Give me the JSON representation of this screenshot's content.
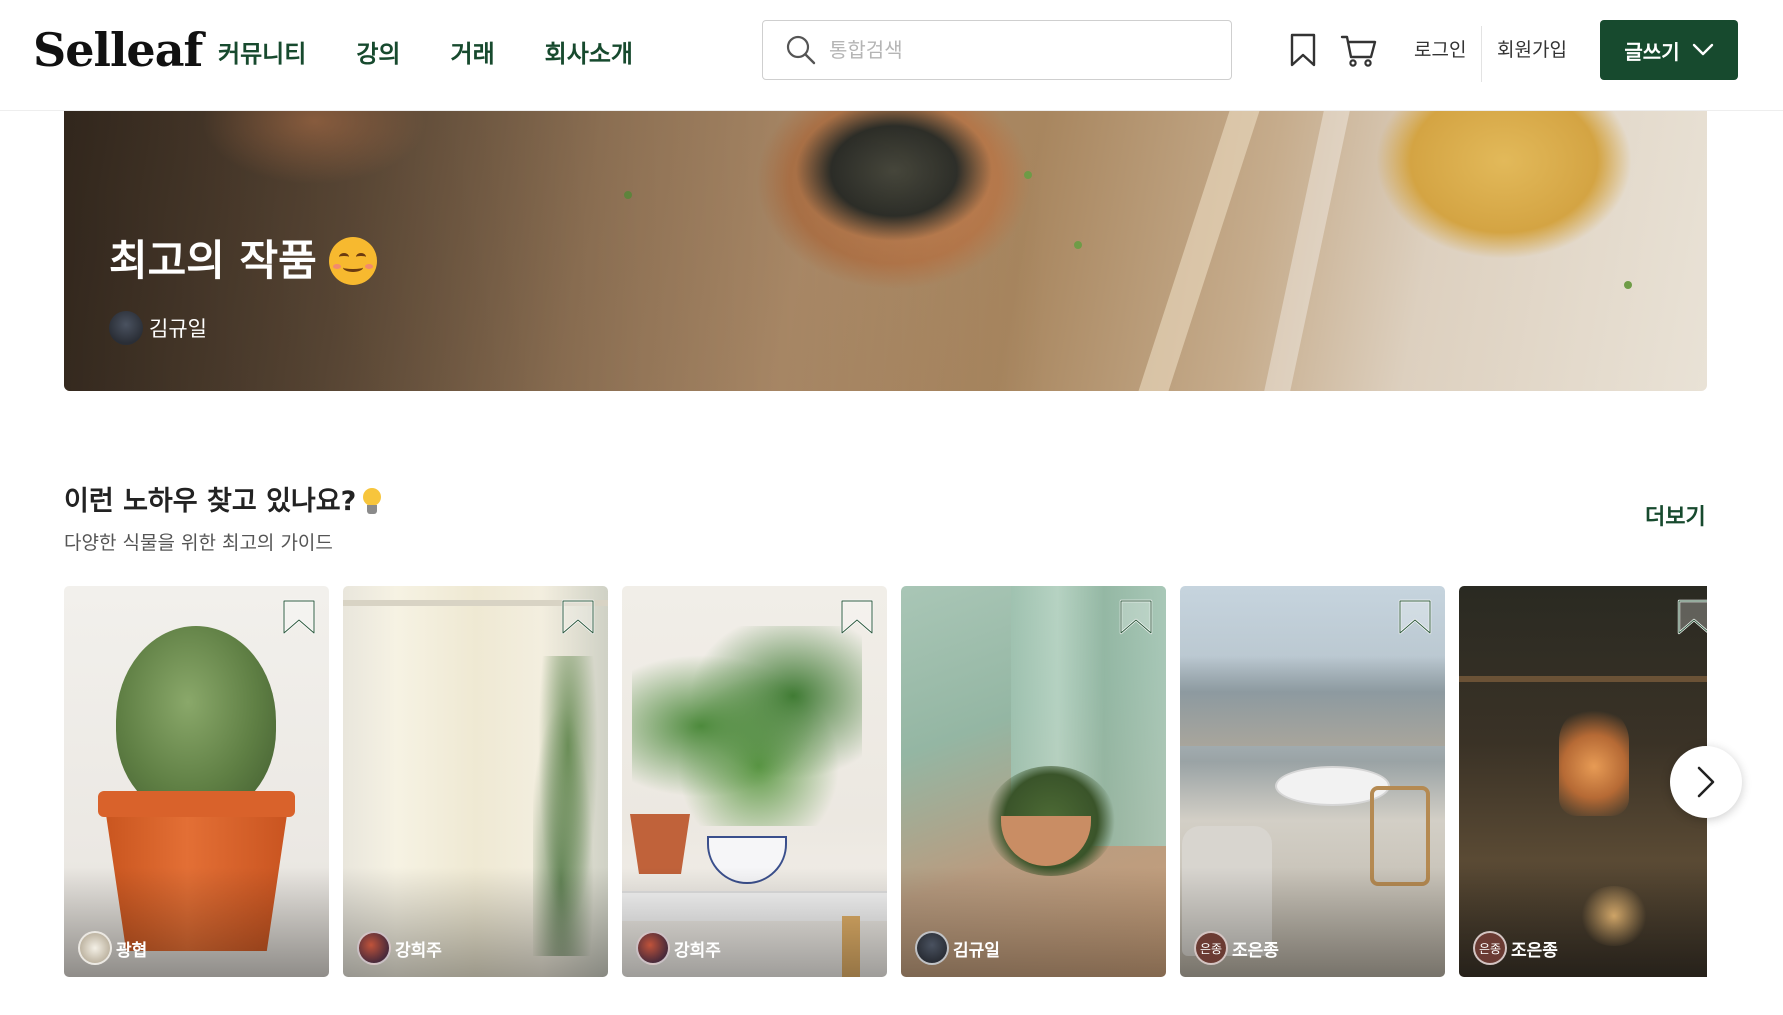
{
  "header": {
    "logo": "Selleaf",
    "nav": [
      "커뮤니티",
      "강의",
      "거래",
      "회사소개"
    ],
    "search_placeholder": "통합검색",
    "search_icon": "search-icon",
    "bookmark_icon": "bookmark-icon",
    "cart_icon": "cart-icon",
    "login": "로그인",
    "signup": "회원가입",
    "write_button": "글쓰기",
    "write_chevron": "chevron-down-icon",
    "brand_color": "#174a2e"
  },
  "hero": {
    "title": "최고의 작품",
    "emoji": "smiling-face-icon",
    "author": "김규일"
  },
  "section": {
    "title": "이런 노하우 찾고 있나요?",
    "title_icon": "lightbulb-icon",
    "subtitle": "다양한 식물을 위한 최고의 가이드",
    "more": "더보기"
  },
  "cards": [
    {
      "author": "광협",
      "avatar_text": ""
    },
    {
      "author": "강희주",
      "avatar_text": ""
    },
    {
      "author": "강희주",
      "avatar_text": ""
    },
    {
      "author": "김규일",
      "avatar_text": ""
    },
    {
      "author": "조은종",
      "avatar_text": "은종"
    },
    {
      "author": "조은종",
      "avatar_text": "은종"
    }
  ],
  "carousel": {
    "next_icon": "chevron-right-icon"
  }
}
